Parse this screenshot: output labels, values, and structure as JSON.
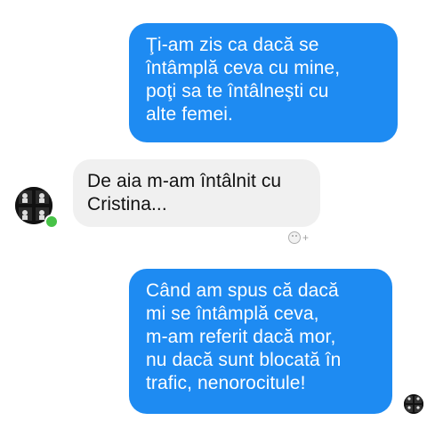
{
  "conversation": {
    "messages": [
      {
        "sender": "me",
        "lines": [
          "Ţi-am zis ca dacă se",
          "întâmplă ceva cu mine,",
          "poţi sa te întâlneşti cu",
          "alte femei."
        ]
      },
      {
        "sender": "contact",
        "lines": [
          "De aia m-am întâlnit cu",
          "Cristina..."
        ]
      },
      {
        "sender": "me",
        "lines": [
          "Când am spus că dacă",
          "mi se întâmplă ceva,",
          "m-am referit dacă mor,",
          "nu dacă sunt blocată în",
          "trafic, nenorocitule!"
        ]
      }
    ]
  },
  "icons": {
    "reaction": "add-reaction-icon",
    "contact_avatar": "contact-avatar",
    "self_avatar": "self-avatar",
    "online_status": "online-status-dot"
  },
  "colors": {
    "outgoing_bubble": "#1e8bf2",
    "incoming_bubble": "#f0f0f0",
    "online_dot": "#47c247",
    "background": "#ffffff"
  }
}
